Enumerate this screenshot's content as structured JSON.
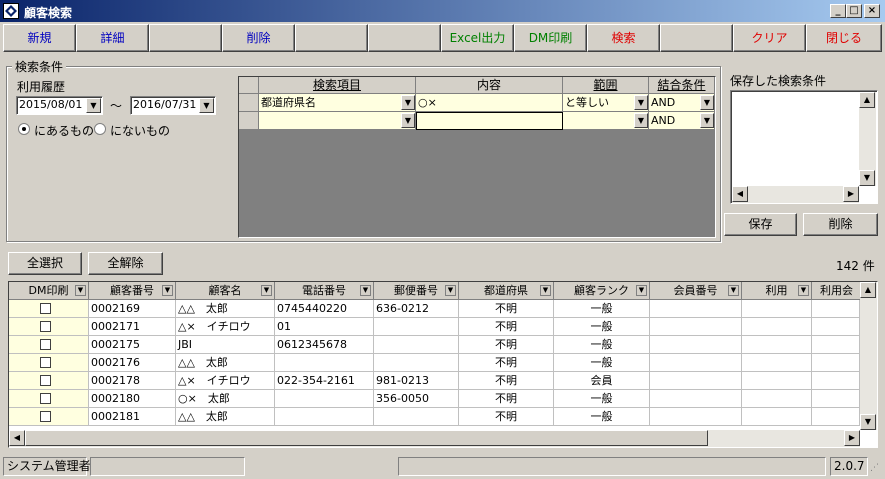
{
  "window": {
    "title": "顧客検索",
    "controls": {
      "minimize": "_",
      "maximize": "□",
      "close": "×"
    }
  },
  "toolbar": {
    "new": "新規",
    "detail": "詳細",
    "delete": "削除",
    "excel": "Excel出力",
    "dm_print": "DM印刷",
    "search": "検索",
    "clear": "クリア",
    "close": "閉じる"
  },
  "search_conditions": {
    "legend": "検索条件",
    "usage_history_label": "利用履歴",
    "date_from": "2015/08/01",
    "tilde": "～",
    "date_to": "2016/07/31",
    "radio_has": "にあるもの",
    "radio_has_not": "にないもの",
    "selected_radio": "has",
    "grid": {
      "headers": [
        "検索項目",
        "内容",
        "範囲",
        "結合条件"
      ],
      "rows": [
        {
          "item": "都道府県名",
          "content": "○×",
          "range": "と等しい",
          "join": "AND"
        },
        {
          "item": "",
          "content": "",
          "range": "",
          "join": "AND"
        }
      ]
    }
  },
  "saved_conditions": {
    "label": "保存した検索条件",
    "save_button": "保存",
    "delete_button": "削除"
  },
  "selection": {
    "select_all": "全選択",
    "deselect_all": "全解除",
    "count": "142 件"
  },
  "results": {
    "headers": [
      "DM印刷",
      "顧客番号",
      "顧客名",
      "電話番号",
      "郵便番号",
      "都道府県",
      "顧客ランク",
      "会員番号",
      "利用",
      "利用会"
    ],
    "rows": [
      {
        "dm": false,
        "id": "0002169",
        "name": "△△　太郎",
        "phone": "0745440220",
        "zip": "636-0212",
        "pref": "不明",
        "rank": "一般",
        "member": "",
        "use": "",
        "use2": ""
      },
      {
        "dm": false,
        "id": "0002171",
        "name": "△×　イチロウ",
        "phone": "01",
        "zip": "",
        "pref": "不明",
        "rank": "一般",
        "member": "",
        "use": "",
        "use2": ""
      },
      {
        "dm": false,
        "id": "0002175",
        "name": "JBI",
        "phone": "0612345678",
        "zip": "",
        "pref": "不明",
        "rank": "一般",
        "member": "",
        "use": "",
        "use2": ""
      },
      {
        "dm": false,
        "id": "0002176",
        "name": "△△　太郎",
        "phone": "",
        "zip": "",
        "pref": "不明",
        "rank": "一般",
        "member": "",
        "use": "",
        "use2": ""
      },
      {
        "dm": false,
        "id": "0002178",
        "name": "△×　イチロウ",
        "phone": "022-354-2161",
        "zip": "981-0213",
        "pref": "不明",
        "rank": "会員",
        "member": "",
        "use": "",
        "use2": ""
      },
      {
        "dm": false,
        "id": "0002180",
        "name": "○×　太郎",
        "phone": "",
        "zip": "356-0050",
        "pref": "不明",
        "rank": "一般",
        "member": "",
        "use": "",
        "use2": ""
      },
      {
        "dm": false,
        "id": "0002181",
        "name": "△△　太郎",
        "phone": "",
        "zip": "",
        "pref": "不明",
        "rank": "一般",
        "member": "",
        "use": "",
        "use2": ""
      }
    ]
  },
  "status": {
    "user": "システム管理者",
    "version": "2.0.7"
  },
  "colors": {
    "title_start": "#0a246a",
    "title_end": "#a6caf0",
    "face": "#d4d0c8",
    "cell_yellow": "#ffffe0",
    "blue_text": "#0000c0",
    "green_text": "#008000",
    "red_text": "#e00000"
  }
}
